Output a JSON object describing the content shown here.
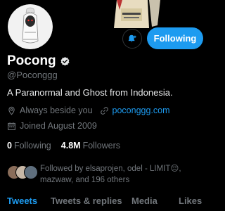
{
  "profile": {
    "name": "Pocong",
    "handle": "@Poconggg",
    "bio": "A Paranormal and Ghost from Indonesia.",
    "location": "Always beside you",
    "website": "poconggg.com",
    "joined": "Joined August 2009"
  },
  "stats": {
    "following_count": "0",
    "following_label": "Following",
    "followers_count": "4.8M",
    "followers_label": "Followers"
  },
  "actions": {
    "following_button": "Following"
  },
  "followed_by": {
    "text": "Followed by elsaprojen, odel - LIMIT😔, mazwaw, and 196 others"
  },
  "tabs": [
    "Tweets",
    "Tweets & replies",
    "Media",
    "Likes"
  ],
  "active_tab": "Tweets",
  "colors": {
    "accent": "#1d9bf0",
    "muted": "#71767b",
    "background": "#000000"
  },
  "icons": [
    "verified-badge-icon",
    "notification-bell-icon",
    "location-pin-icon",
    "link-icon",
    "calendar-icon"
  ]
}
